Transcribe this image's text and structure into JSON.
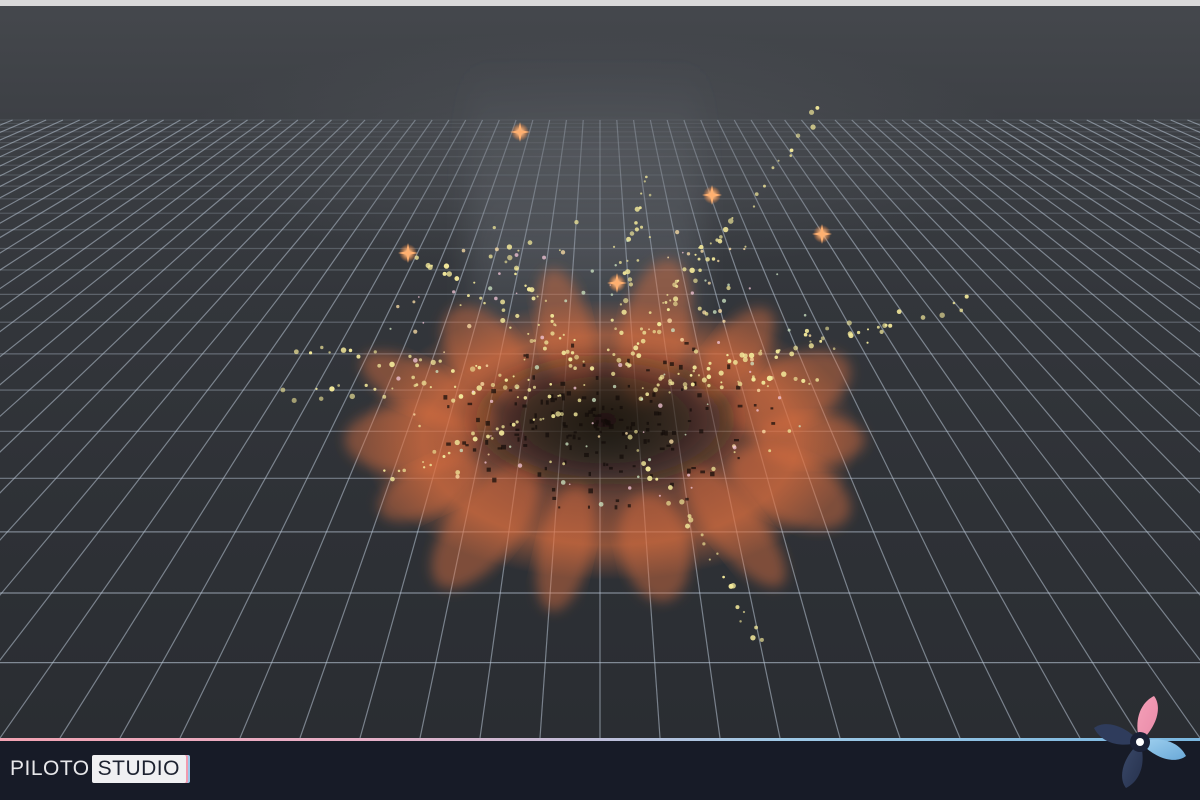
{
  "brand": {
    "name_part1": "PILOTO",
    "name_part2": "STUDIO",
    "logo_icon": "pinwheel-fan-icon"
  },
  "scene": {
    "description_type": "vfx-preview",
    "effect_colors": {
      "fire": "#e0703f",
      "smoke": "#1a120e",
      "sparks": "#f2e89a",
      "flare": "#ffb070",
      "grid_line": "#b9c6d6"
    }
  },
  "ui_colors": {
    "bar_background": "#171b27",
    "stripe_left": "#f2a3b3",
    "stripe_right": "#7ab7e0"
  }
}
